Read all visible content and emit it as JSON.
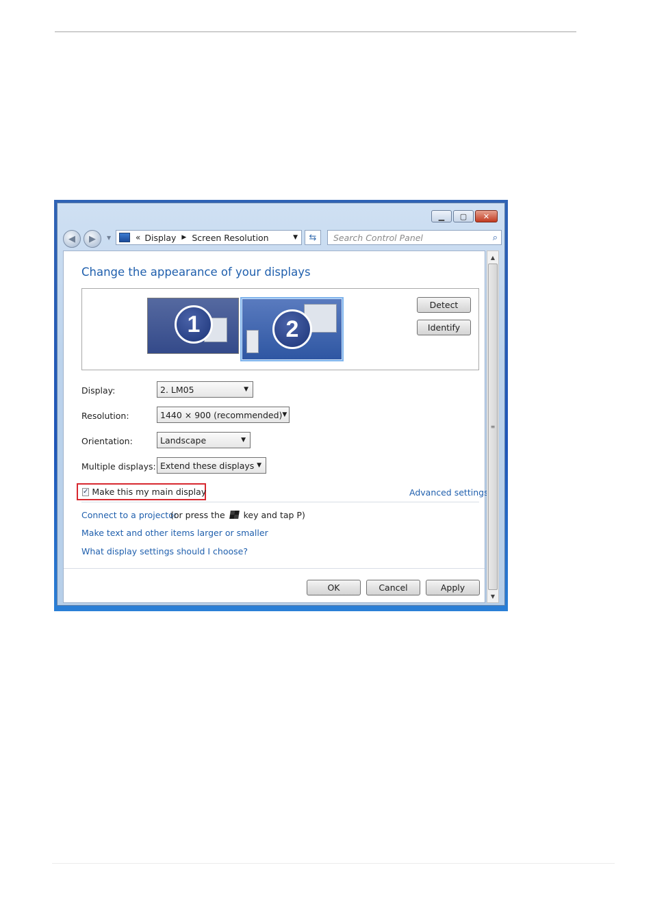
{
  "window": {
    "address": {
      "prefix": "«",
      "crumbs": [
        "Display",
        "Screen Resolution"
      ]
    },
    "search_placeholder": "Search Control Panel"
  },
  "main": {
    "title": "Change the appearance of your displays",
    "monitors": [
      "1",
      "2"
    ],
    "detect_label": "Detect",
    "identify_label": "Identify",
    "fields": {
      "display_label": "Display:",
      "display_value": "2. LM05",
      "resolution_label": "Resolution:",
      "resolution_value": "1440 × 900 (recommended)",
      "orientation_label": "Orientation:",
      "orientation_value": "Landscape",
      "multiple_label": "Multiple displays:",
      "multiple_value": "Extend these displays"
    },
    "main_display_checkbox": {
      "label": "Make this my main display",
      "checked": true
    },
    "advanced_link": "Advanced settings",
    "projector_link": "Connect to a projector",
    "projector_text_a": "(or press the",
    "projector_text_b": "key and tap P)",
    "text_size_link": "Make text and other items larger or smaller",
    "help_link": "What display settings should I choose?"
  },
  "footer": {
    "ok_label": "OK",
    "cancel_label": "Cancel",
    "apply_label": "Apply"
  }
}
